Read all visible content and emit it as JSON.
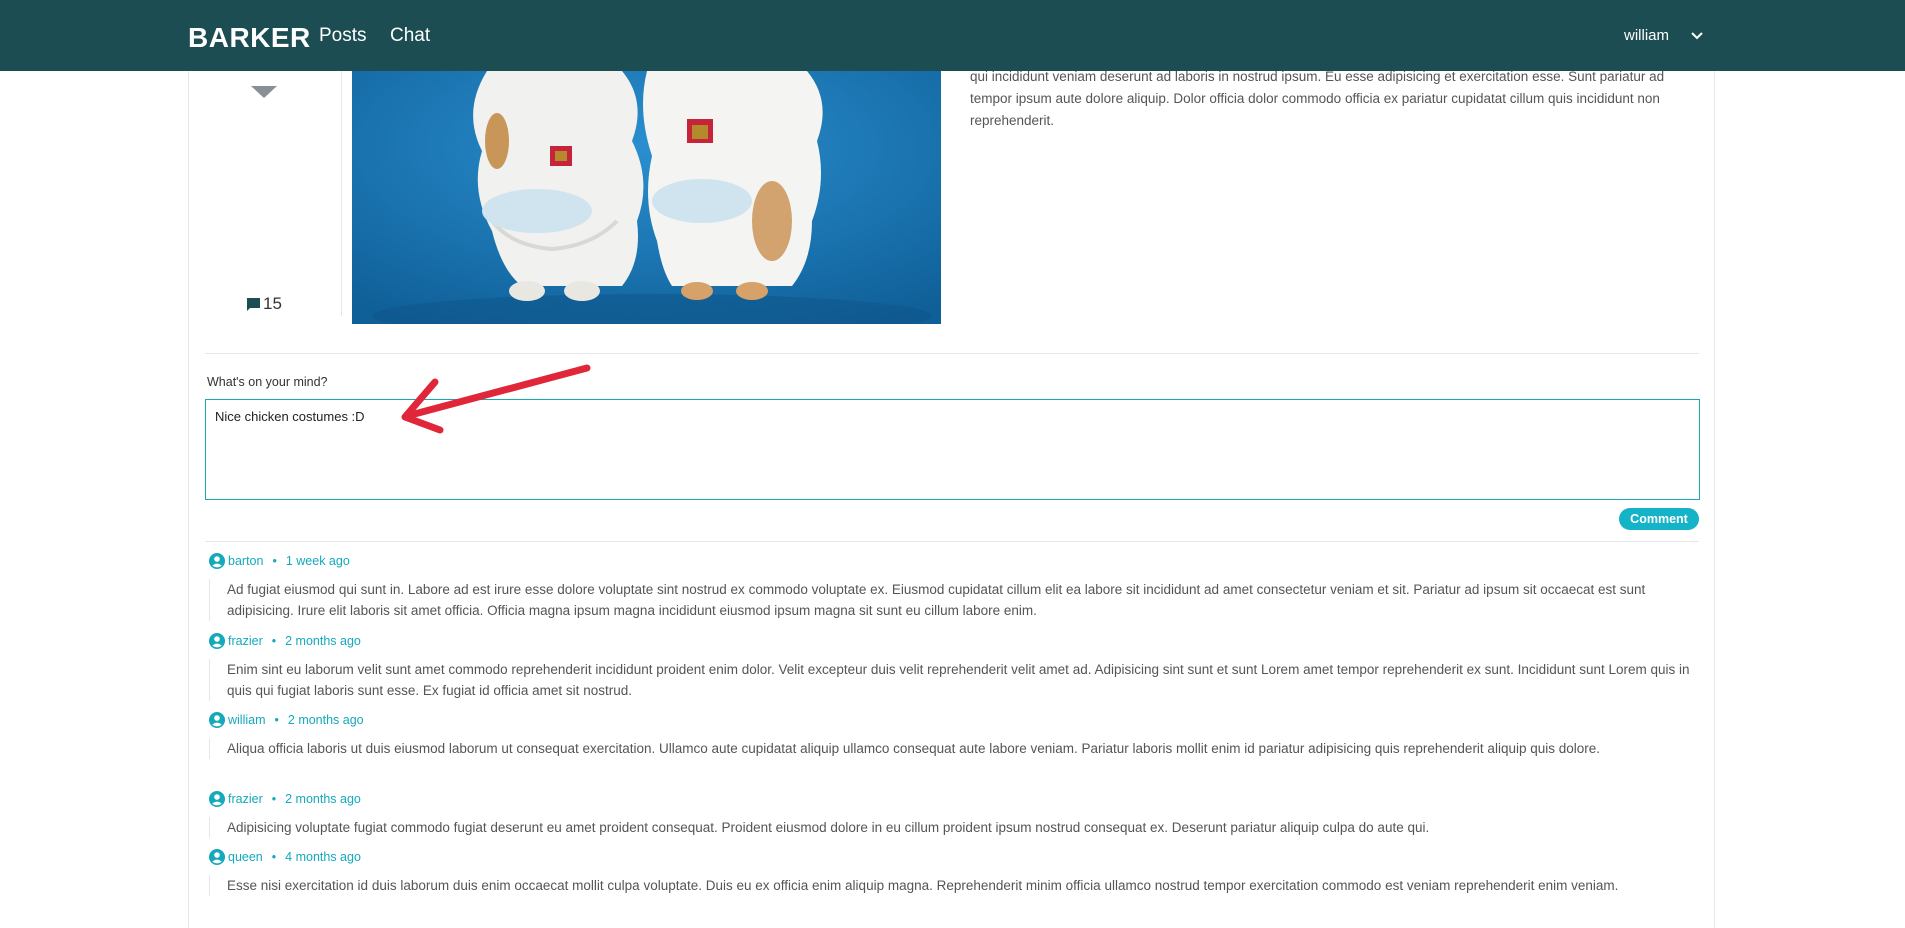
{
  "nav": {
    "brand": "BARKER",
    "links": [
      "Posts",
      "Chat"
    ],
    "username": "william"
  },
  "post": {
    "comment_count": "15",
    "body": "qui incididunt veniam deserunt ad laboris in nostrud ipsum. Eu esse adipisicing et exercitation esse. Sunt pariatur ad tempor ipsum aute dolore aliquip. Dolor officia dolor commodo officia ex pariatur cupidatat cillum quis incididunt non reprehenderit."
  },
  "comment_form": {
    "label": "What's on your mind?",
    "value": "Nice chicken costumes :D",
    "submit_label": "Comment"
  },
  "comments": [
    {
      "user": "barton",
      "time": "1 week ago",
      "text": "Ad fugiat eiusmod qui sunt in. Labore ad est irure esse dolore voluptate sint nostrud ex commodo voluptate ex. Eiusmod cupidatat cillum elit ea labore sit incididunt ad amet consectetur veniam et sit. Pariatur ad ipsum sit occaecat est sunt adipisicing. Irure elit laboris sit amet officia. Officia magna ipsum magna incididunt eiusmod ipsum magna sit sunt eu cillum labore enim."
    },
    {
      "user": "frazier",
      "time": "2 months ago",
      "text": "Enim sint eu laborum velit sunt amet commodo reprehenderit incididunt proident enim dolor. Velit excepteur duis velit reprehenderit velit amet ad. Adipisicing sint sunt et sunt Lorem amet tempor reprehenderit ex sunt. Incididunt sunt Lorem quis in quis qui fugiat laboris sunt esse. Ex fugiat id officia amet sit nostrud."
    },
    {
      "user": "william",
      "time": "2 months ago",
      "text": "Aliqua officia laboris ut duis eiusmod laborum ut consequat exercitation. Ullamco aute cupidatat aliquip ullamco consequat aute labore veniam. Pariatur laboris mollit enim id pariatur adipisicing quis reprehenderit aliquip quis dolore."
    },
    {
      "user": "frazier",
      "time": "2 months ago",
      "text": "Adipisicing voluptate fugiat commodo fugiat deserunt eu amet proident consequat. Proident eiusmod dolore in eu cillum proident ipsum nostrud consequat ex. Deserunt pariatur aliquip culpa do aute qui."
    },
    {
      "user": "queen",
      "time": "4 months ago",
      "text": "Esse nisi exercitation id duis laborum duis enim occaecat mollit culpa voluptate. Duis eu ex officia enim aliquip magna. Reprehenderit minim officia ullamco nostrud tempor exercitation commodo est veniam reprehenderit enim veniam."
    }
  ],
  "colors": {
    "navbar": "#1c4d52",
    "accent": "#14b3c8",
    "annotation_arrow": "#e0273a"
  }
}
